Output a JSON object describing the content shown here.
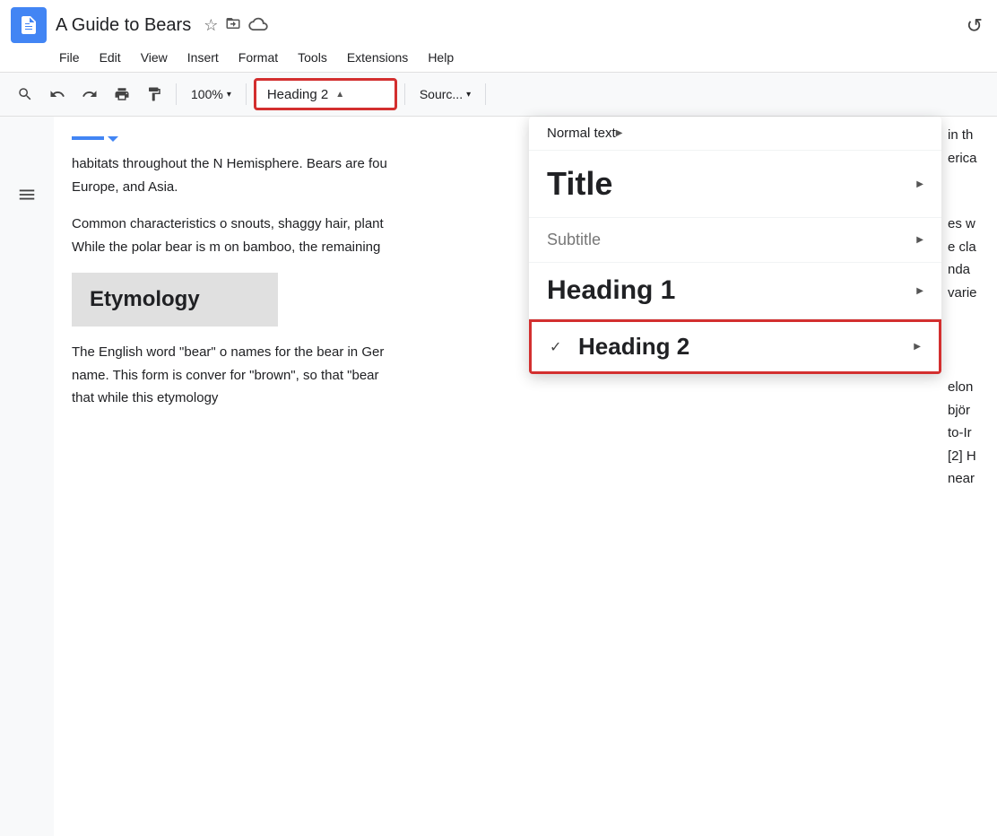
{
  "app": {
    "name": "Google Docs",
    "doc_title": "A Guide to Bears"
  },
  "title_icons": {
    "star": "☆",
    "folder": "⊡",
    "cloud": "☁"
  },
  "menu": {
    "items": [
      "File",
      "Edit",
      "View",
      "Insert",
      "Format",
      "Tools",
      "Extensions",
      "Help"
    ]
  },
  "toolbar": {
    "zoom": "100%",
    "zoom_arrow": "▾",
    "heading_selected": "Heading 2",
    "heading_arrow": "▲",
    "source": "Sourc...",
    "source_arrow": "▾"
  },
  "document": {
    "paragraph1": "habitats throughout the N Hemisphere. Bears are fou Europe, and Asia.",
    "paragraph2": "Common characteristics o snouts, shaggy hair, plant While the polar bear is m on bamboo, the remaining",
    "etymology_title": "Etymology",
    "etymology_para": "The English word \"bear\" o names for the bear in Ger name. This form is conver for \"brown\", so that \"bear that while this etymology"
  },
  "right_side_text": {
    "line1": "in th",
    "line2": "erica",
    "line3": "es w",
    "line4": "e cla",
    "line5": "nda",
    "line6": "varie",
    "line7": "elon",
    "line8": "björ",
    "line9": "to-Ir",
    "line10": "[2] H",
    "line11": "near"
  },
  "dropdown_menu": {
    "items": [
      {
        "id": "normal-text",
        "label": "Normal text",
        "style": "normal",
        "has_arrow": true,
        "checked": false
      },
      {
        "id": "title",
        "label": "Title",
        "style": "title",
        "has_arrow": true,
        "checked": false
      },
      {
        "id": "subtitle",
        "label": "Subtitle",
        "style": "subtitle",
        "has_arrow": true,
        "checked": false
      },
      {
        "id": "heading1",
        "label": "Heading 1",
        "style": "heading1",
        "has_arrow": true,
        "checked": false
      },
      {
        "id": "heading2",
        "label": "Heading 2",
        "style": "heading2",
        "has_arrow": true,
        "checked": true
      }
    ],
    "checkmark": "✓"
  },
  "colors": {
    "accent_red": "#d32f2f",
    "accent_blue": "#4285f4",
    "text_primary": "#202124",
    "text_gray": "#777"
  }
}
